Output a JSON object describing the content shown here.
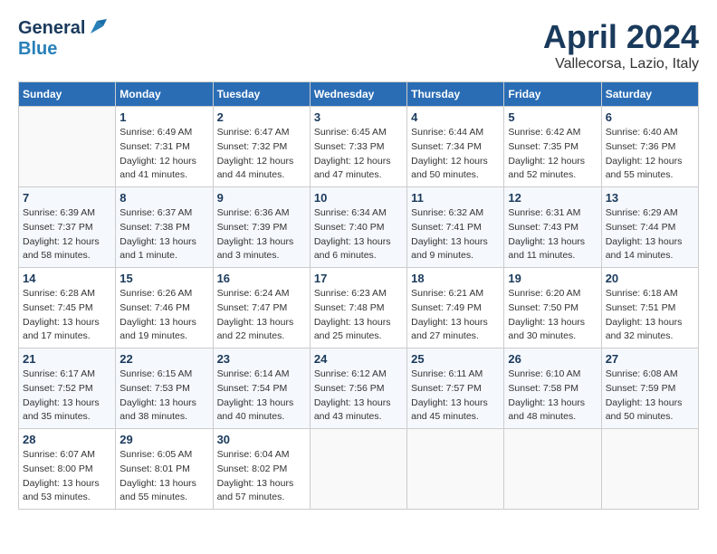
{
  "header": {
    "logo_general": "General",
    "logo_blue": "Blue",
    "month": "April 2024",
    "location": "Vallecorsa, Lazio, Italy"
  },
  "weekdays": [
    "Sunday",
    "Monday",
    "Tuesday",
    "Wednesday",
    "Thursday",
    "Friday",
    "Saturday"
  ],
  "weeks": [
    [
      {
        "day": "",
        "sunrise": "",
        "sunset": "",
        "daylight": ""
      },
      {
        "day": "1",
        "sunrise": "Sunrise: 6:49 AM",
        "sunset": "Sunset: 7:31 PM",
        "daylight": "Daylight: 12 hours and 41 minutes."
      },
      {
        "day": "2",
        "sunrise": "Sunrise: 6:47 AM",
        "sunset": "Sunset: 7:32 PM",
        "daylight": "Daylight: 12 hours and 44 minutes."
      },
      {
        "day": "3",
        "sunrise": "Sunrise: 6:45 AM",
        "sunset": "Sunset: 7:33 PM",
        "daylight": "Daylight: 12 hours and 47 minutes."
      },
      {
        "day": "4",
        "sunrise": "Sunrise: 6:44 AM",
        "sunset": "Sunset: 7:34 PM",
        "daylight": "Daylight: 12 hours and 50 minutes."
      },
      {
        "day": "5",
        "sunrise": "Sunrise: 6:42 AM",
        "sunset": "Sunset: 7:35 PM",
        "daylight": "Daylight: 12 hours and 52 minutes."
      },
      {
        "day": "6",
        "sunrise": "Sunrise: 6:40 AM",
        "sunset": "Sunset: 7:36 PM",
        "daylight": "Daylight: 12 hours and 55 minutes."
      }
    ],
    [
      {
        "day": "7",
        "sunrise": "Sunrise: 6:39 AM",
        "sunset": "Sunset: 7:37 PM",
        "daylight": "Daylight: 12 hours and 58 minutes."
      },
      {
        "day": "8",
        "sunrise": "Sunrise: 6:37 AM",
        "sunset": "Sunset: 7:38 PM",
        "daylight": "Daylight: 13 hours and 1 minute."
      },
      {
        "day": "9",
        "sunrise": "Sunrise: 6:36 AM",
        "sunset": "Sunset: 7:39 PM",
        "daylight": "Daylight: 13 hours and 3 minutes."
      },
      {
        "day": "10",
        "sunrise": "Sunrise: 6:34 AM",
        "sunset": "Sunset: 7:40 PM",
        "daylight": "Daylight: 13 hours and 6 minutes."
      },
      {
        "day": "11",
        "sunrise": "Sunrise: 6:32 AM",
        "sunset": "Sunset: 7:41 PM",
        "daylight": "Daylight: 13 hours and 9 minutes."
      },
      {
        "day": "12",
        "sunrise": "Sunrise: 6:31 AM",
        "sunset": "Sunset: 7:43 PM",
        "daylight": "Daylight: 13 hours and 11 minutes."
      },
      {
        "day": "13",
        "sunrise": "Sunrise: 6:29 AM",
        "sunset": "Sunset: 7:44 PM",
        "daylight": "Daylight: 13 hours and 14 minutes."
      }
    ],
    [
      {
        "day": "14",
        "sunrise": "Sunrise: 6:28 AM",
        "sunset": "Sunset: 7:45 PM",
        "daylight": "Daylight: 13 hours and 17 minutes."
      },
      {
        "day": "15",
        "sunrise": "Sunrise: 6:26 AM",
        "sunset": "Sunset: 7:46 PM",
        "daylight": "Daylight: 13 hours and 19 minutes."
      },
      {
        "day": "16",
        "sunrise": "Sunrise: 6:24 AM",
        "sunset": "Sunset: 7:47 PM",
        "daylight": "Daylight: 13 hours and 22 minutes."
      },
      {
        "day": "17",
        "sunrise": "Sunrise: 6:23 AM",
        "sunset": "Sunset: 7:48 PM",
        "daylight": "Daylight: 13 hours and 25 minutes."
      },
      {
        "day": "18",
        "sunrise": "Sunrise: 6:21 AM",
        "sunset": "Sunset: 7:49 PM",
        "daylight": "Daylight: 13 hours and 27 minutes."
      },
      {
        "day": "19",
        "sunrise": "Sunrise: 6:20 AM",
        "sunset": "Sunset: 7:50 PM",
        "daylight": "Daylight: 13 hours and 30 minutes."
      },
      {
        "day": "20",
        "sunrise": "Sunrise: 6:18 AM",
        "sunset": "Sunset: 7:51 PM",
        "daylight": "Daylight: 13 hours and 32 minutes."
      }
    ],
    [
      {
        "day": "21",
        "sunrise": "Sunrise: 6:17 AM",
        "sunset": "Sunset: 7:52 PM",
        "daylight": "Daylight: 13 hours and 35 minutes."
      },
      {
        "day": "22",
        "sunrise": "Sunrise: 6:15 AM",
        "sunset": "Sunset: 7:53 PM",
        "daylight": "Daylight: 13 hours and 38 minutes."
      },
      {
        "day": "23",
        "sunrise": "Sunrise: 6:14 AM",
        "sunset": "Sunset: 7:54 PM",
        "daylight": "Daylight: 13 hours and 40 minutes."
      },
      {
        "day": "24",
        "sunrise": "Sunrise: 6:12 AM",
        "sunset": "Sunset: 7:56 PM",
        "daylight": "Daylight: 13 hours and 43 minutes."
      },
      {
        "day": "25",
        "sunrise": "Sunrise: 6:11 AM",
        "sunset": "Sunset: 7:57 PM",
        "daylight": "Daylight: 13 hours and 45 minutes."
      },
      {
        "day": "26",
        "sunrise": "Sunrise: 6:10 AM",
        "sunset": "Sunset: 7:58 PM",
        "daylight": "Daylight: 13 hours and 48 minutes."
      },
      {
        "day": "27",
        "sunrise": "Sunrise: 6:08 AM",
        "sunset": "Sunset: 7:59 PM",
        "daylight": "Daylight: 13 hours and 50 minutes."
      }
    ],
    [
      {
        "day": "28",
        "sunrise": "Sunrise: 6:07 AM",
        "sunset": "Sunset: 8:00 PM",
        "daylight": "Daylight: 13 hours and 53 minutes."
      },
      {
        "day": "29",
        "sunrise": "Sunrise: 6:05 AM",
        "sunset": "Sunset: 8:01 PM",
        "daylight": "Daylight: 13 hours and 55 minutes."
      },
      {
        "day": "30",
        "sunrise": "Sunrise: 6:04 AM",
        "sunset": "Sunset: 8:02 PM",
        "daylight": "Daylight: 13 hours and 57 minutes."
      },
      {
        "day": "",
        "sunrise": "",
        "sunset": "",
        "daylight": ""
      },
      {
        "day": "",
        "sunrise": "",
        "sunset": "",
        "daylight": ""
      },
      {
        "day": "",
        "sunrise": "",
        "sunset": "",
        "daylight": ""
      },
      {
        "day": "",
        "sunrise": "",
        "sunset": "",
        "daylight": ""
      }
    ]
  ]
}
